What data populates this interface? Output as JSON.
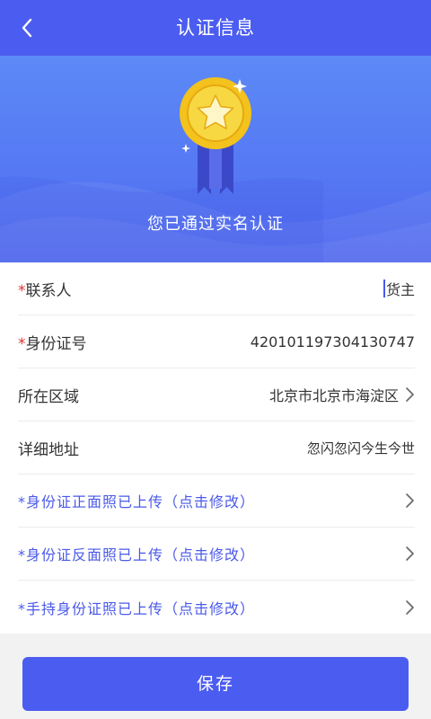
{
  "header": {
    "title": "认证信息",
    "back_icon": "chevron-left-icon"
  },
  "banner": {
    "status_text": "您已通过实名认证",
    "medal_icon": "medal-star-icon"
  },
  "form": {
    "contact": {
      "required_mark": "*",
      "label": "联系人",
      "value": "货主"
    },
    "id_number": {
      "required_mark": "*",
      "label": "身份证号",
      "value": "420101197304130747"
    },
    "region": {
      "label": "所在区域",
      "value": "北京市北京市海淀区"
    },
    "address": {
      "label": "详细地址",
      "value": "忽闪忽闪今生今世"
    },
    "id_front": {
      "label": "*身份证正面照已上传（点击修改）"
    },
    "id_back": {
      "label": "*身份证反面照已上传（点击修改）"
    },
    "id_handheld": {
      "label": "*手持身份证照已上传（点击修改）"
    }
  },
  "footer": {
    "save_label": "保存"
  },
  "colors": {
    "primary": "#4b5cf0",
    "required": "#e0312f",
    "link": "#4a59e8"
  }
}
